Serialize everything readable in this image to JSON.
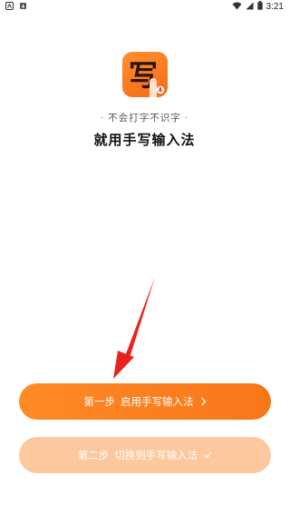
{
  "status_bar": {
    "time": "3:21",
    "icons": [
      "notification-icon",
      "download-icon",
      "wifi-icon",
      "signal-icon",
      "battery-icon"
    ]
  },
  "app": {
    "icon_glyph": "写",
    "accent_color": "#f7761a",
    "tagline_dot": "·",
    "tagline": "不会打字不识字",
    "title": "就用手写输入法"
  },
  "buttons": {
    "step1": {
      "step": "第一步",
      "label": "启用手写输入法",
      "suffix_icon": "chevron-right-icon"
    },
    "step2": {
      "step": "第二步",
      "label": "切换到手写输入法",
      "suffix_icon": "checkmark-icon"
    }
  },
  "pointer_arrow_icon": "red-arrow-icon"
}
